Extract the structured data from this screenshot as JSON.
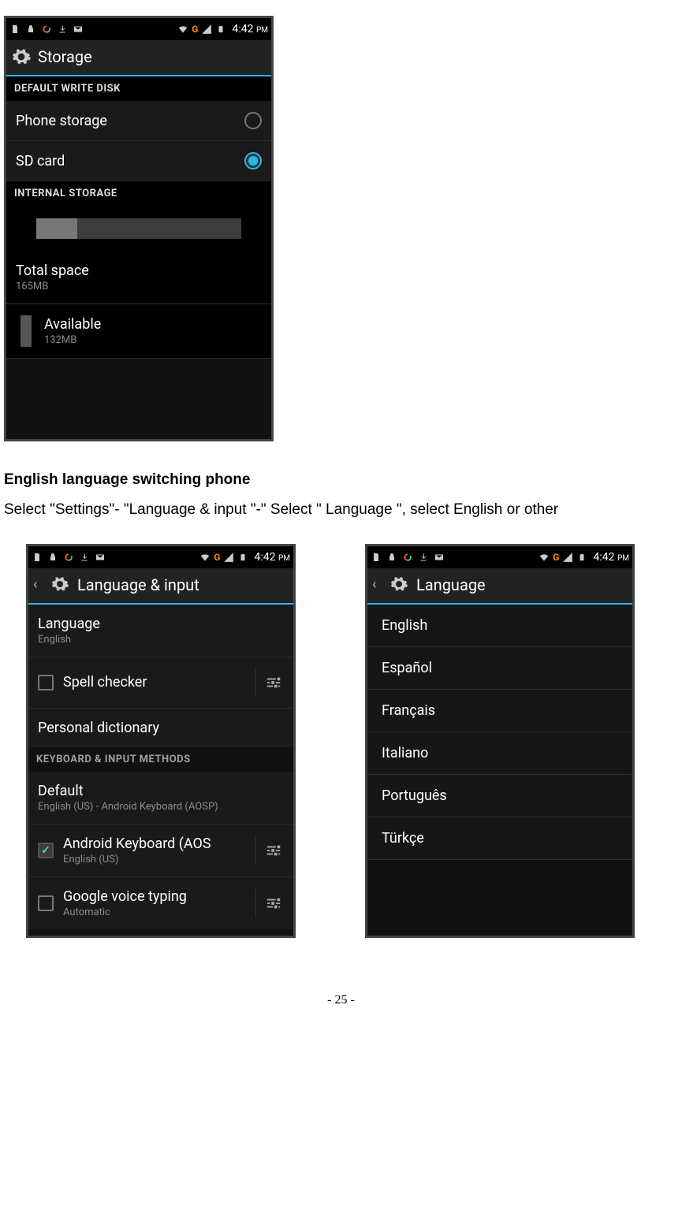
{
  "status_time": "4:42",
  "status_ampm": "PM",
  "status_g": "G",
  "phone_storage": {
    "title": "Storage",
    "section1": "DEFAULT WRITE DISK",
    "opt_phone": "Phone storage",
    "opt_sd": "SD card",
    "section2": "INTERNAL STORAGE",
    "total_label": "Total space",
    "total_value": "165MB",
    "avail_label": "Available",
    "avail_value": "132MB"
  },
  "doc": {
    "heading": "English language switching phone",
    "para": "Select \"Settings\"- \"Language & input \"-\" Select \" Language \", select English or other"
  },
  "phone_langinput": {
    "title": "Language & input",
    "lang_label": "Language",
    "lang_value": "English",
    "spell": "Spell checker",
    "personal_dict": "Personal dictionary",
    "kb_section": "KEYBOARD & INPUT METHODS",
    "default_label": "Default",
    "default_value": "English (US) - Android Keyboard (AOSP)",
    "aosp_label": "Android Keyboard (AOS",
    "aosp_sub": "English (US)",
    "gvoice_label": "Google voice typing",
    "gvoice_sub": "Automatic"
  },
  "phone_langlist": {
    "title": "Language",
    "items": [
      "English",
      "Español",
      "Français",
      "Italiano",
      "Português",
      "Türkçe"
    ]
  },
  "page_number": "- 25 -"
}
